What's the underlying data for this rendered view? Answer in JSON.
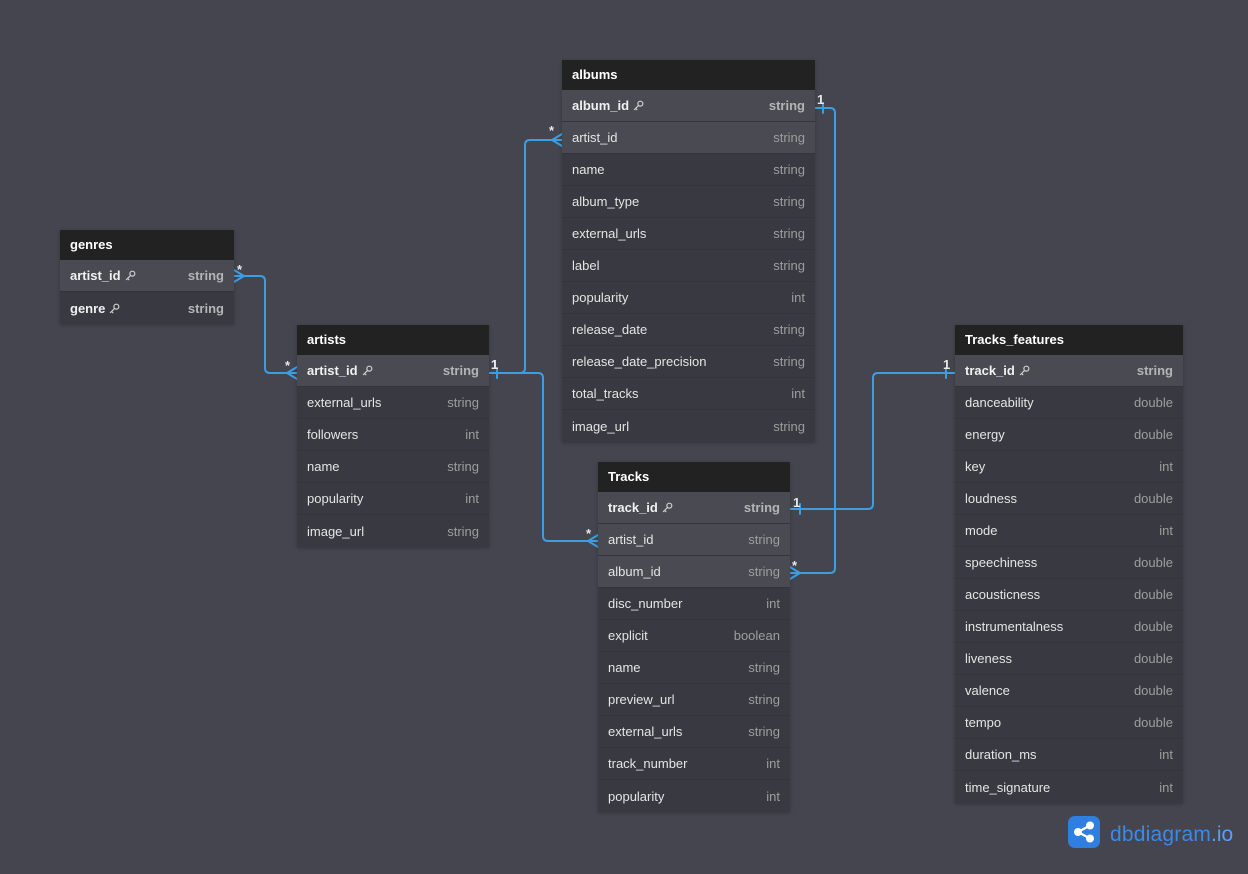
{
  "tables": {
    "genres": {
      "title": "genres",
      "columns": [
        {
          "name": "artist_id",
          "type": "string",
          "pk": true,
          "highlighted": true
        },
        {
          "name": "genre",
          "type": "string",
          "pk": true,
          "highlighted": false
        }
      ]
    },
    "artists": {
      "title": "artists",
      "columns": [
        {
          "name": "artist_id",
          "type": "string",
          "pk": true,
          "highlighted": true
        },
        {
          "name": "external_urls",
          "type": "string"
        },
        {
          "name": "followers",
          "type": "int"
        },
        {
          "name": "name",
          "type": "string"
        },
        {
          "name": "popularity",
          "type": "int"
        },
        {
          "name": "image_url",
          "type": "string"
        }
      ]
    },
    "albums": {
      "title": "albums",
      "columns": [
        {
          "name": "album_id",
          "type": "string",
          "pk": true,
          "highlighted": true
        },
        {
          "name": "artist_id",
          "type": "string",
          "highlighted": true
        },
        {
          "name": "name",
          "type": "string"
        },
        {
          "name": "album_type",
          "type": "string"
        },
        {
          "name": "external_urls",
          "type": "string"
        },
        {
          "name": "label",
          "type": "string"
        },
        {
          "name": "popularity",
          "type": "int"
        },
        {
          "name": "release_date",
          "type": "string"
        },
        {
          "name": "release_date_precision",
          "type": "string"
        },
        {
          "name": "total_tracks",
          "type": "int"
        },
        {
          "name": "image_url",
          "type": "string"
        }
      ]
    },
    "tracks": {
      "title": "Tracks",
      "columns": [
        {
          "name": "track_id",
          "type": "string",
          "pk": true,
          "highlighted": true
        },
        {
          "name": "artist_id",
          "type": "string",
          "highlighted": true
        },
        {
          "name": "album_id",
          "type": "string",
          "highlighted": true
        },
        {
          "name": "disc_number",
          "type": "int"
        },
        {
          "name": "explicit",
          "type": "boolean"
        },
        {
          "name": "name",
          "type": "string"
        },
        {
          "name": "preview_url",
          "type": "string"
        },
        {
          "name": "external_urls",
          "type": "string"
        },
        {
          "name": "track_number",
          "type": "int"
        },
        {
          "name": "popularity",
          "type": "int"
        }
      ]
    },
    "tracks_features": {
      "title": "Tracks_features",
      "columns": [
        {
          "name": "track_id",
          "type": "string",
          "pk": true,
          "highlighted": true
        },
        {
          "name": "danceability",
          "type": "double"
        },
        {
          "name": "energy",
          "type": "double"
        },
        {
          "name": "key",
          "type": "int"
        },
        {
          "name": "loudness",
          "type": "double"
        },
        {
          "name": "mode",
          "type": "int"
        },
        {
          "name": "speechiness",
          "type": "double"
        },
        {
          "name": "acousticness",
          "type": "double"
        },
        {
          "name": "instrumentalness",
          "type": "double"
        },
        {
          "name": "liveness",
          "type": "double"
        },
        {
          "name": "valence",
          "type": "double"
        },
        {
          "name": "tempo",
          "type": "double"
        },
        {
          "name": "duration_ms",
          "type": "int"
        },
        {
          "name": "time_signature",
          "type": "int"
        }
      ]
    }
  },
  "relationships": [
    {
      "from_label": "*",
      "to_label": "*"
    },
    {
      "from_label": "1",
      "to_label": "*"
    },
    {
      "from_label": "1",
      "to_label": "*"
    },
    {
      "from_label": "1",
      "to_label": "*"
    },
    {
      "from_label": "1",
      "to_label": "1"
    }
  ],
  "icons": {
    "primary_key": "key-icon",
    "logo": "dbdiagram-logo-icon"
  },
  "logo": {
    "name": "dbdiagram",
    "suffix": ".io"
  },
  "colors": {
    "canvas": "#44454e",
    "header": "#222222",
    "row": "#393a41",
    "row_highlight": "#4a4b52",
    "line": "#3b9ee3",
    "logo": "#2f7fe0"
  }
}
